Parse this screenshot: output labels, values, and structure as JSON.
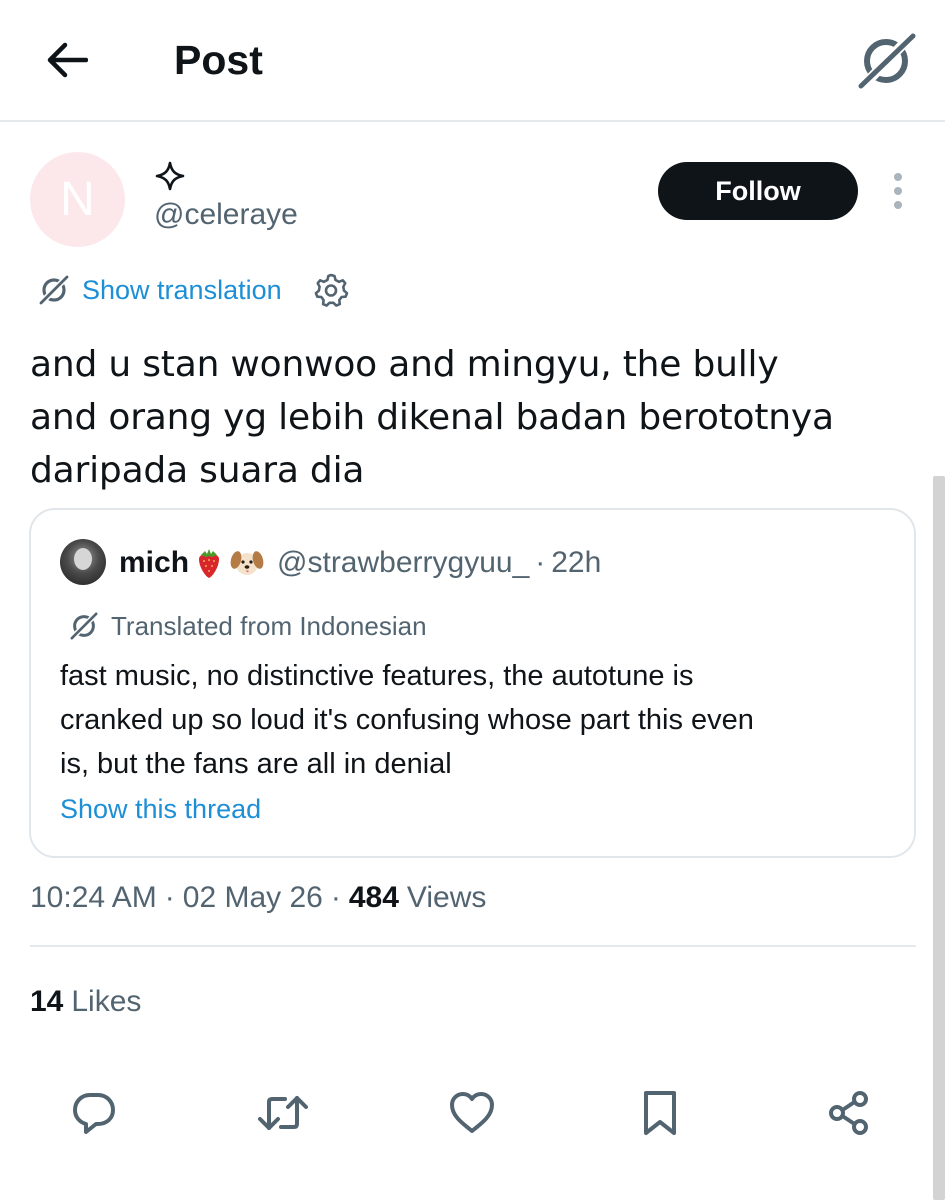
{
  "header": {
    "title": "Post",
    "back_icon": "arrow-left-icon",
    "logo_icon": "grok-logo-icon"
  },
  "author": {
    "avatar_letter": "N",
    "avatar_bg": "#fce8ea",
    "name_icon": "sparkle-icon",
    "handle": "@celeraye",
    "follow_label": "Follow"
  },
  "translation": {
    "link_label": "Show translation",
    "settings_icon": "gear-icon"
  },
  "post": {
    "lines": [
      "and u stan wonwoo and mingyu, the bully",
      "and orang yg lebih dikenal badan berototnya",
      "daripada suara dia"
    ]
  },
  "quote": {
    "name": "mich",
    "emojis": [
      "strawberry-emoji",
      "dog-face-emoji"
    ],
    "handle": "@strawberrygyuu_",
    "dot": "·",
    "time": "22h",
    "translated_label": "Translated from Indonesian",
    "body_lines": [
      "fast music, no distinctive features, the autotune is",
      "cranked up so loud it's confusing whose part this even",
      "is, but the fans are all in denial"
    ],
    "thread_link": "Show this thread"
  },
  "meta": {
    "time": "10:24 AM",
    "sep1": "·",
    "date": "02 May 26",
    "sep2": "·",
    "views_count": "484",
    "views_label": "Views"
  },
  "likes": {
    "count": "14",
    "label": "Likes"
  },
  "actions": [
    {
      "icon": "reply-icon"
    },
    {
      "icon": "retweet-icon"
    },
    {
      "icon": "heart-icon"
    },
    {
      "icon": "bookmark-icon"
    },
    {
      "icon": "share-icon"
    }
  ],
  "colors": {
    "text": "#0f1419",
    "secondary": "#536471",
    "link": "#1d8fd6",
    "follow_bg": "#0f1419"
  }
}
